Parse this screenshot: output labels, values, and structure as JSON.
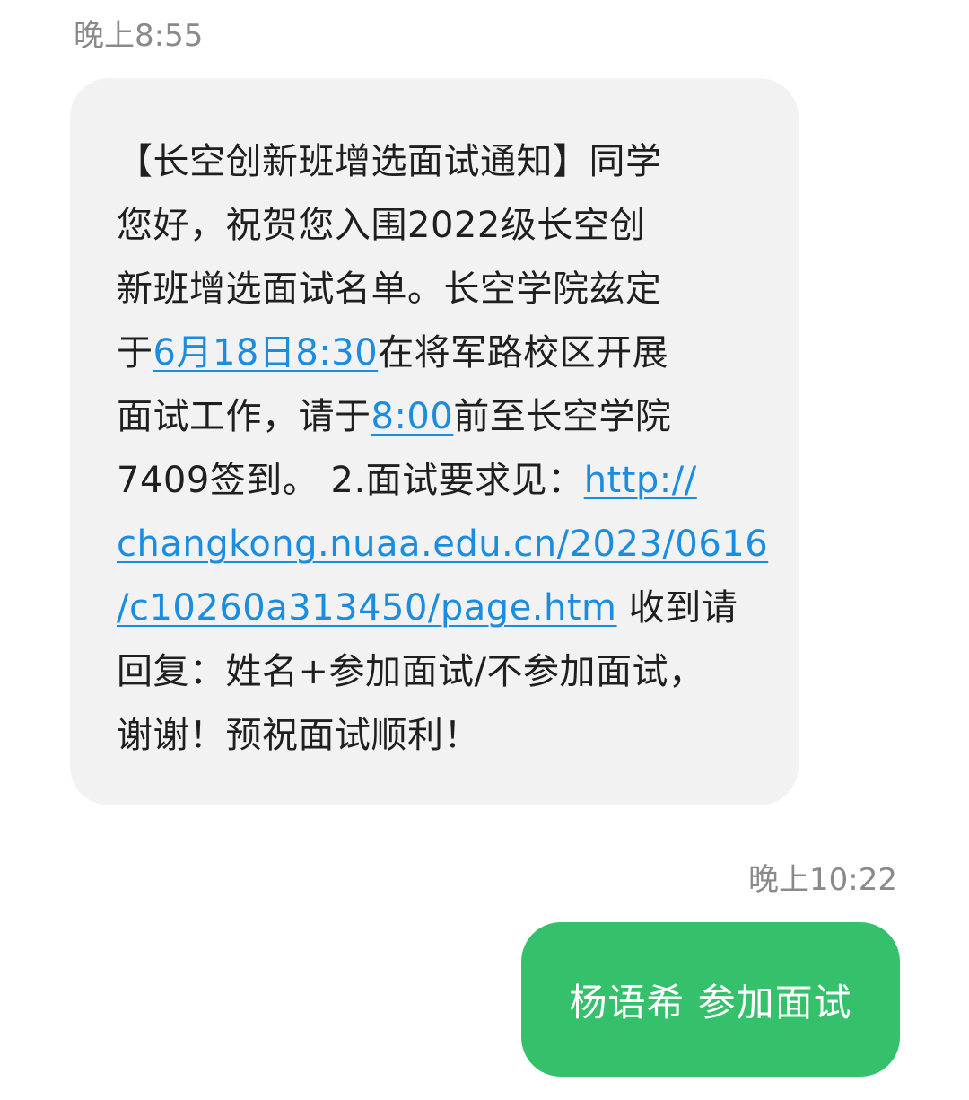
{
  "colors": {
    "incoming_bubble": "#f2f2f2",
    "outgoing_bubble": "#35c16c",
    "link": "#1a8de0",
    "timestamp": "#8a8a8a"
  },
  "incoming_message": {
    "time": "晚上8:55",
    "lines": [
      {
        "text": "【长空创新班增选面试通知】同学"
      },
      {
        "text": "您好，祝贺您入围2022级长空创"
      },
      {
        "text": "新班增选面试名单。长空学院兹定"
      },
      {
        "pre": "于",
        "link": "6月18日8:30",
        "post": "在将军路校区开展"
      },
      {
        "pre": "面试工作，请于",
        "link": "8:00",
        "post": "前至长空学院"
      },
      {
        "pre": "7409签到。 2.面试要求见：",
        "link": "http://",
        "post": ""
      },
      {
        "pre": "",
        "link": "changkong.nuaa.edu.cn/2023/0616",
        "post": ""
      },
      {
        "pre": "",
        "link": "/c10260a313450/page.htm",
        "post": " 收到请"
      },
      {
        "text": "回复：姓名+参加面试/不参加面试，"
      },
      {
        "text": "谢谢！预祝面试顺利！"
      }
    ]
  },
  "outgoing_message": {
    "time": "晚上10:22",
    "text": "杨语希 参加面试"
  }
}
